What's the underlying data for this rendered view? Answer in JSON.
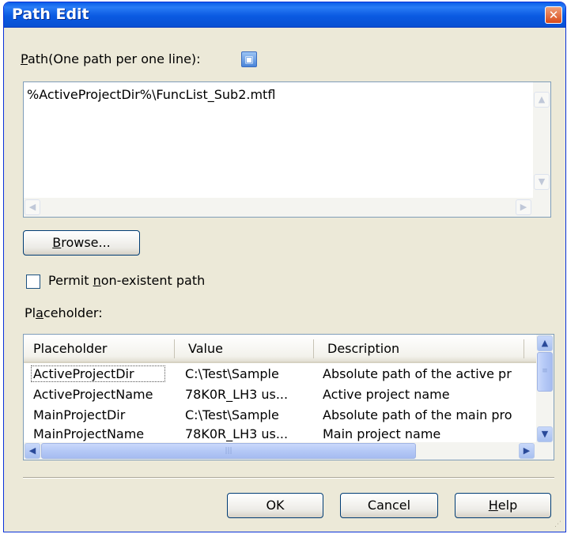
{
  "window": {
    "title": "Path Edit",
    "close_glyph": "✕"
  },
  "path": {
    "label_mnemonic": "P",
    "label_rest": "ath(One path per one line):",
    "help_icon": "info-icon",
    "textarea_value": "%ActiveProjectDir%\\FuncList_Sub2.mtfl"
  },
  "browse": {
    "mnemonic": "B",
    "rest": "rowse..."
  },
  "permit": {
    "before": "Permit ",
    "mnemonic": "n",
    "after": "on-existent path",
    "checked": false
  },
  "placeholder": {
    "label_before": "Pl",
    "label_mnemonic": "a",
    "label_after": "ceholder:",
    "columns": [
      "Placeholder",
      "Value",
      "Description"
    ],
    "rows": [
      {
        "placeholder": "ActiveProjectDir",
        "value": "C:\\Test\\Sample",
        "description": "Absolute path of the active pr"
      },
      {
        "placeholder": "ActiveProjectName",
        "value": "78K0R_LH3 us...",
        "description": "Active project name"
      },
      {
        "placeholder": "MainProjectDir",
        "value": "C:\\Test\\Sample",
        "description": "Absolute path of the main pro"
      },
      {
        "placeholder": "MainProjectName",
        "value": "78K0R_LH3 us...",
        "description": "Main project name"
      }
    ]
  },
  "footer": {
    "ok_label": "OK",
    "cancel_label": "Cancel",
    "help_mnemonic": "H",
    "help_rest": "elp"
  },
  "colors": {
    "title_bar": "#0a5ee8",
    "dialog_bg": "#ece9d8",
    "close_button": "#d84a1a"
  }
}
